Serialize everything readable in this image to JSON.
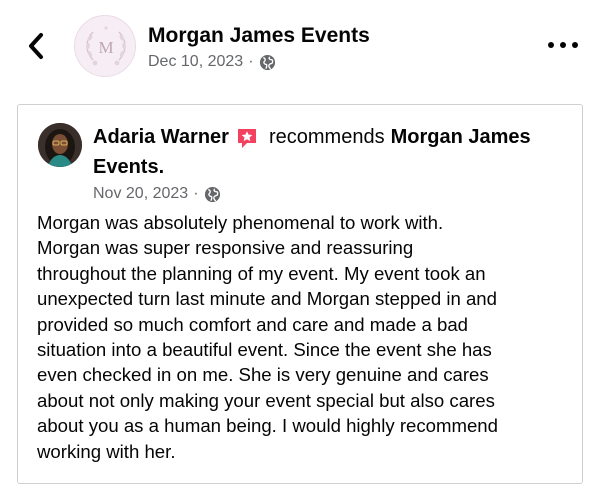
{
  "header": {
    "page_name": "Morgan James Events",
    "post_date": "Dec 10, 2023",
    "separator": "·",
    "avatar_monogram": "M",
    "icons": {
      "back": "chevron-left-icon",
      "privacy": "globe-icon",
      "more": "more-horizontal-icon"
    }
  },
  "review": {
    "reviewer_name": "Adaria Warner",
    "verb": "recommends",
    "target_part1": "Morgan James",
    "target_part2": "Events.",
    "date": "Nov 20, 2023",
    "separator": "·",
    "badge_icon": "recommend-star-icon",
    "badge_color": "#f3425f",
    "text": "Morgan was absolutely phenomenal to work with.\nMorgan was super responsive and reassuring\nthroughout the planning of my event. My event took an\nunexpected turn last minute and Morgan stepped in and\nprovided so much comfort and care and made a bad\nsituation into a beautiful event. Since the event she has\neven checked in on me. She is very genuine and cares\nabout not only making your event special but also cares\nabout you as a human being. I would highly recommend\nworking with her."
  },
  "colors": {
    "text_primary": "#050505",
    "text_secondary": "#65676b",
    "border": "#ced0d4"
  }
}
